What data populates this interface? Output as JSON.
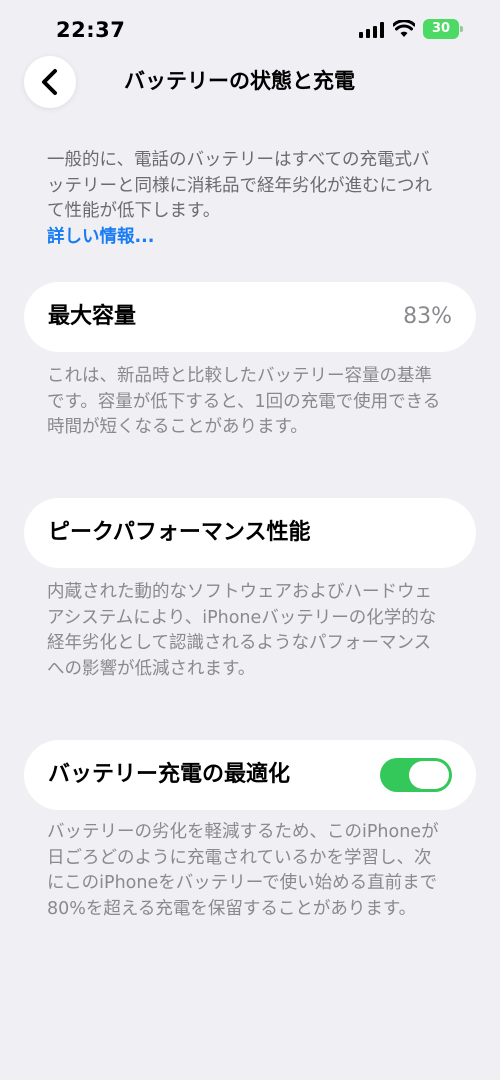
{
  "status_bar": {
    "time": "22:37",
    "battery_level": "30",
    "battery_color": "#4cd964"
  },
  "nav": {
    "back_icon": "chevron-left-icon",
    "title": "バッテリーの状態と充電"
  },
  "intro": {
    "text": "一般的に、電話のバッテリーはすべての充電式バッテリーと同様に消耗品で経年劣化が進むにつれて性能が低下します。",
    "link_label": "詳しい情報..."
  },
  "max_capacity": {
    "label": "最大容量",
    "value": "83%",
    "description": "これは、新品時と比較したバッテリー容量の基準です。容量が低下すると、1回の充電で使用できる時間が短くなることがあります。"
  },
  "peak_performance": {
    "label": "ピークパフォーマンス性能",
    "description": "内蔵された動的なソフトウェアおよびハードウェアシステムにより、iPhoneバッテリーの化学的な経年劣化として認識されるようなパフォーマンスへの影響が低減されます。"
  },
  "optimized_charging": {
    "label": "バッテリー充電の最適化",
    "enabled": true,
    "toggle_color": "#34c759",
    "description": "バッテリーの劣化を軽減するため、このiPhoneが日ごろどのように充電されているかを学習し、次にこのiPhoneをバッテリーで使い始める直前まで80%を超える充電を保留することがあります。"
  }
}
